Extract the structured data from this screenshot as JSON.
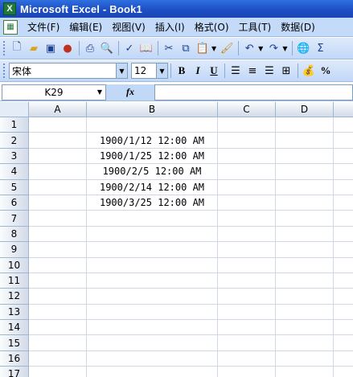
{
  "window": {
    "title": "Microsoft Excel - Book1"
  },
  "menu": {
    "items": [
      "文件(F)",
      "编辑(E)",
      "视图(V)",
      "插入(I)",
      "格式(O)",
      "工具(T)",
      "数据(D)"
    ]
  },
  "format_toolbar": {
    "font_name": "宋体",
    "font_size": "12",
    "bold": "B",
    "italic": "I",
    "underline": "U",
    "percent": "%"
  },
  "formula_bar": {
    "name_box": "K29",
    "fx": "fx",
    "formula": ""
  },
  "sheet": {
    "columns": [
      "A",
      "B",
      "C",
      "D"
    ],
    "rows": [
      {
        "num": "1",
        "B": ""
      },
      {
        "num": "2",
        "B": "1900/1/12 12:00 AM"
      },
      {
        "num": "3",
        "B": "1900/1/25 12:00 AM"
      },
      {
        "num": "4",
        "B": "1900/2/5 12:00 AM"
      },
      {
        "num": "5",
        "B": "1900/2/14 12:00 AM"
      },
      {
        "num": "6",
        "B": "1900/3/25 12:00 AM"
      },
      {
        "num": "7",
        "B": ""
      },
      {
        "num": "8",
        "B": ""
      },
      {
        "num": "9",
        "B": ""
      },
      {
        "num": "10",
        "B": ""
      },
      {
        "num": "11",
        "B": ""
      },
      {
        "num": "12",
        "B": ""
      },
      {
        "num": "13",
        "B": ""
      },
      {
        "num": "14",
        "B": ""
      },
      {
        "num": "15",
        "B": ""
      },
      {
        "num": "16",
        "B": ""
      },
      {
        "num": "17",
        "B": ""
      }
    ]
  }
}
